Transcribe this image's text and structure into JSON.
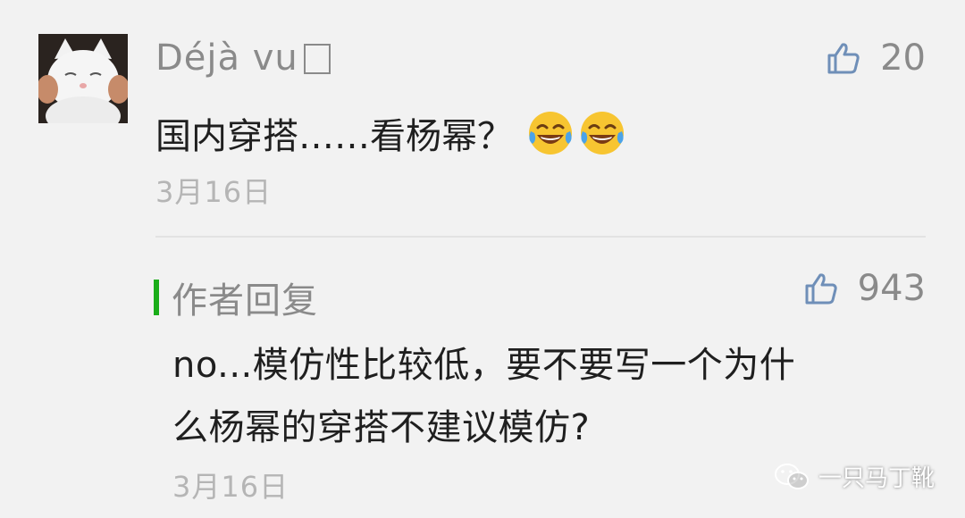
{
  "comment": {
    "username": "Déjà vu",
    "likes": "20",
    "text": "国内穿搭……看杨幂？",
    "date": "3月16日",
    "emoji": "tears-of-joy-emoji"
  },
  "author_reply": {
    "label": "作者回复",
    "likes": "943",
    "text_line1": "no...模仿性比较低，要不要写一个为什",
    "text_line2": "么杨幂的穿搭不建议模仿?",
    "date": "3月16日"
  },
  "watermark": {
    "text": "一只马丁靴",
    "icon": "wechat-icon"
  },
  "colors": {
    "accent_green": "#1aad19",
    "like_blue": "#6f8fb8",
    "muted_text": "#8a8a8a",
    "body_text": "#1f1f1f"
  }
}
